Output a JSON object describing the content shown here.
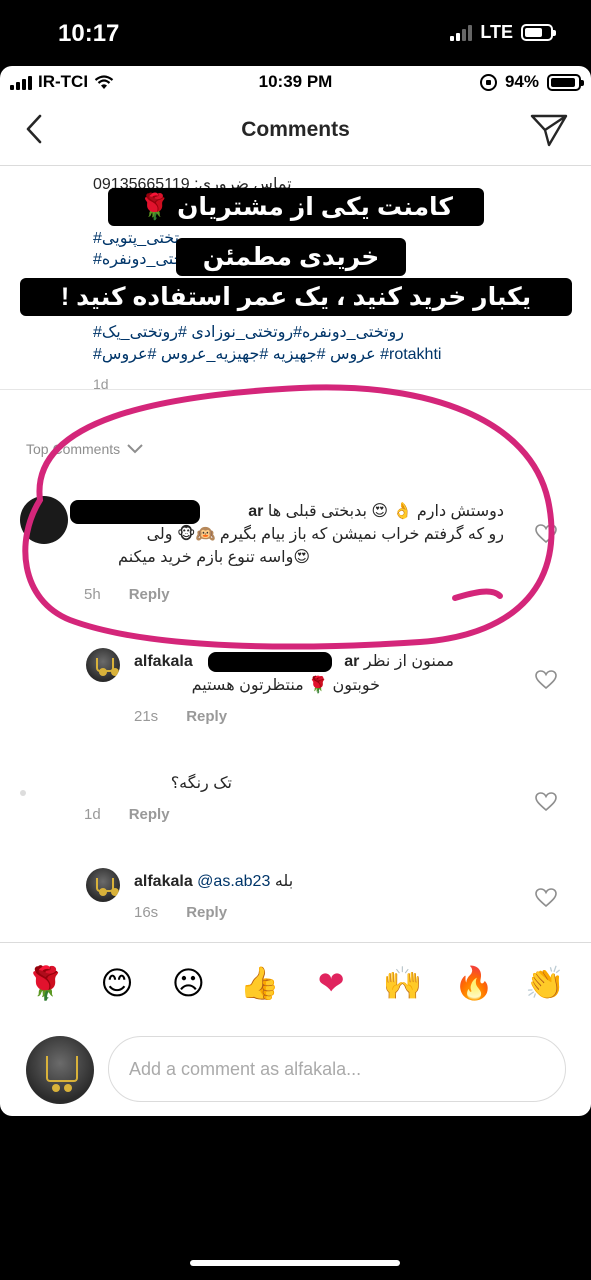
{
  "outer_status": {
    "time": "10:17",
    "network": "LTE"
  },
  "inner_status": {
    "carrier": "IR-TCI",
    "time": "10:39 PM",
    "battery": "94%"
  },
  "nav": {
    "title": "Comments",
    "back_icon": "chevron-left-icon",
    "send_icon": "paper-plane-icon"
  },
  "caption": {
    "lines": [
      "تماس ضروری: 09135665119",
      "#روتختی_پتویی",
      "#روتختی_دونفره",
      "#روتختی_دونفره#روتختی_نوزادی #روتختی_یک",
      "#عروس #جهیزیه #جهیزیه_عروس #عروس #rotakhti"
    ],
    "time": "1d"
  },
  "overlay": {
    "line1": "کامنت یکی از مشتریان 🌹",
    "line2": "خریدی مطمئن",
    "line3": "یکبار خرید کنید ، یک عمر استفاده کنید !"
  },
  "top_comments_label": "Top Comments",
  "comments": [
    {
      "user": "ar",
      "text_line1": "دوستش دارم 👌 😍 بدبختی قبلی ها",
      "text_line2": "رو که گرفتم خراب نمیشن که باز بیام بگیرم 🙉🐵 ولی",
      "text_line3": "😍واسه تنوع بازم خرید میکنم",
      "time": "5h",
      "reply": "Reply"
    },
    {
      "user": "alfakala",
      "user_suffix": "ar",
      "text_line1": "ممنون از نظر",
      "text_line2": "خوبتون 🌹 منتظرتون هستیم",
      "time": "21s",
      "reply": "Reply"
    },
    {
      "text_line1": "تک رنگه؟",
      "time": "1d",
      "reply": "Reply"
    },
    {
      "user": "alfakala",
      "mention": "@as.ab23",
      "text_line1": "بله",
      "time": "16s",
      "reply": "Reply"
    }
  ],
  "emoji_bar": [
    "🌹",
    "😊",
    "☹",
    "👍",
    "❤",
    "🙌",
    "🔥",
    "👏"
  ],
  "compose": {
    "placeholder": "Add a comment as alfakala..."
  },
  "colors": {
    "annotation": "#d4267a",
    "link": "#003569"
  }
}
